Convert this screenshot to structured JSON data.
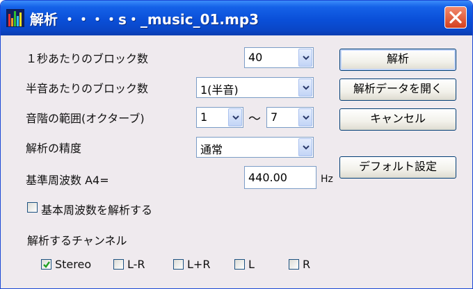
{
  "window": {
    "title_prefix": "解析",
    "title_file": "・・・・s・_music_01.mp3",
    "close_icon": "close-icon"
  },
  "blocks_per_second": {
    "label": "１秒あたりのブロック数",
    "value": "40"
  },
  "blocks_per_semitone": {
    "label": "半音あたりのブロック数",
    "value": "1(半音)"
  },
  "scale_range": {
    "label": "音階の範囲(オクターブ)",
    "from": "1",
    "separator": "～",
    "to": "7"
  },
  "precision": {
    "label": "解析の精度",
    "value": "通常"
  },
  "base_frequency": {
    "label": "基準周波数 A4=",
    "value": "440.00",
    "unit": "Hz"
  },
  "analyze_fundamental": {
    "label": "基本周波数を解析する",
    "checked": false
  },
  "channels": {
    "label": "解析するチャンネル",
    "items": [
      {
        "label": "Stereo",
        "checked": true
      },
      {
        "label": "L-R",
        "checked": false
      },
      {
        "label": "L+R",
        "checked": false
      },
      {
        "label": "L",
        "checked": false
      },
      {
        "label": "R",
        "checked": false
      }
    ]
  },
  "buttons": {
    "analyze": "解析",
    "open_data": "解析データを開く",
    "cancel": "キャンセル",
    "defaults": "デフォルト設定"
  },
  "colors": {
    "titlebar": "#0a4fd8",
    "dialog_bg": "#efeaee",
    "close_button": "#d4401e",
    "border": "#7a9cc6",
    "check": "#21a121"
  }
}
